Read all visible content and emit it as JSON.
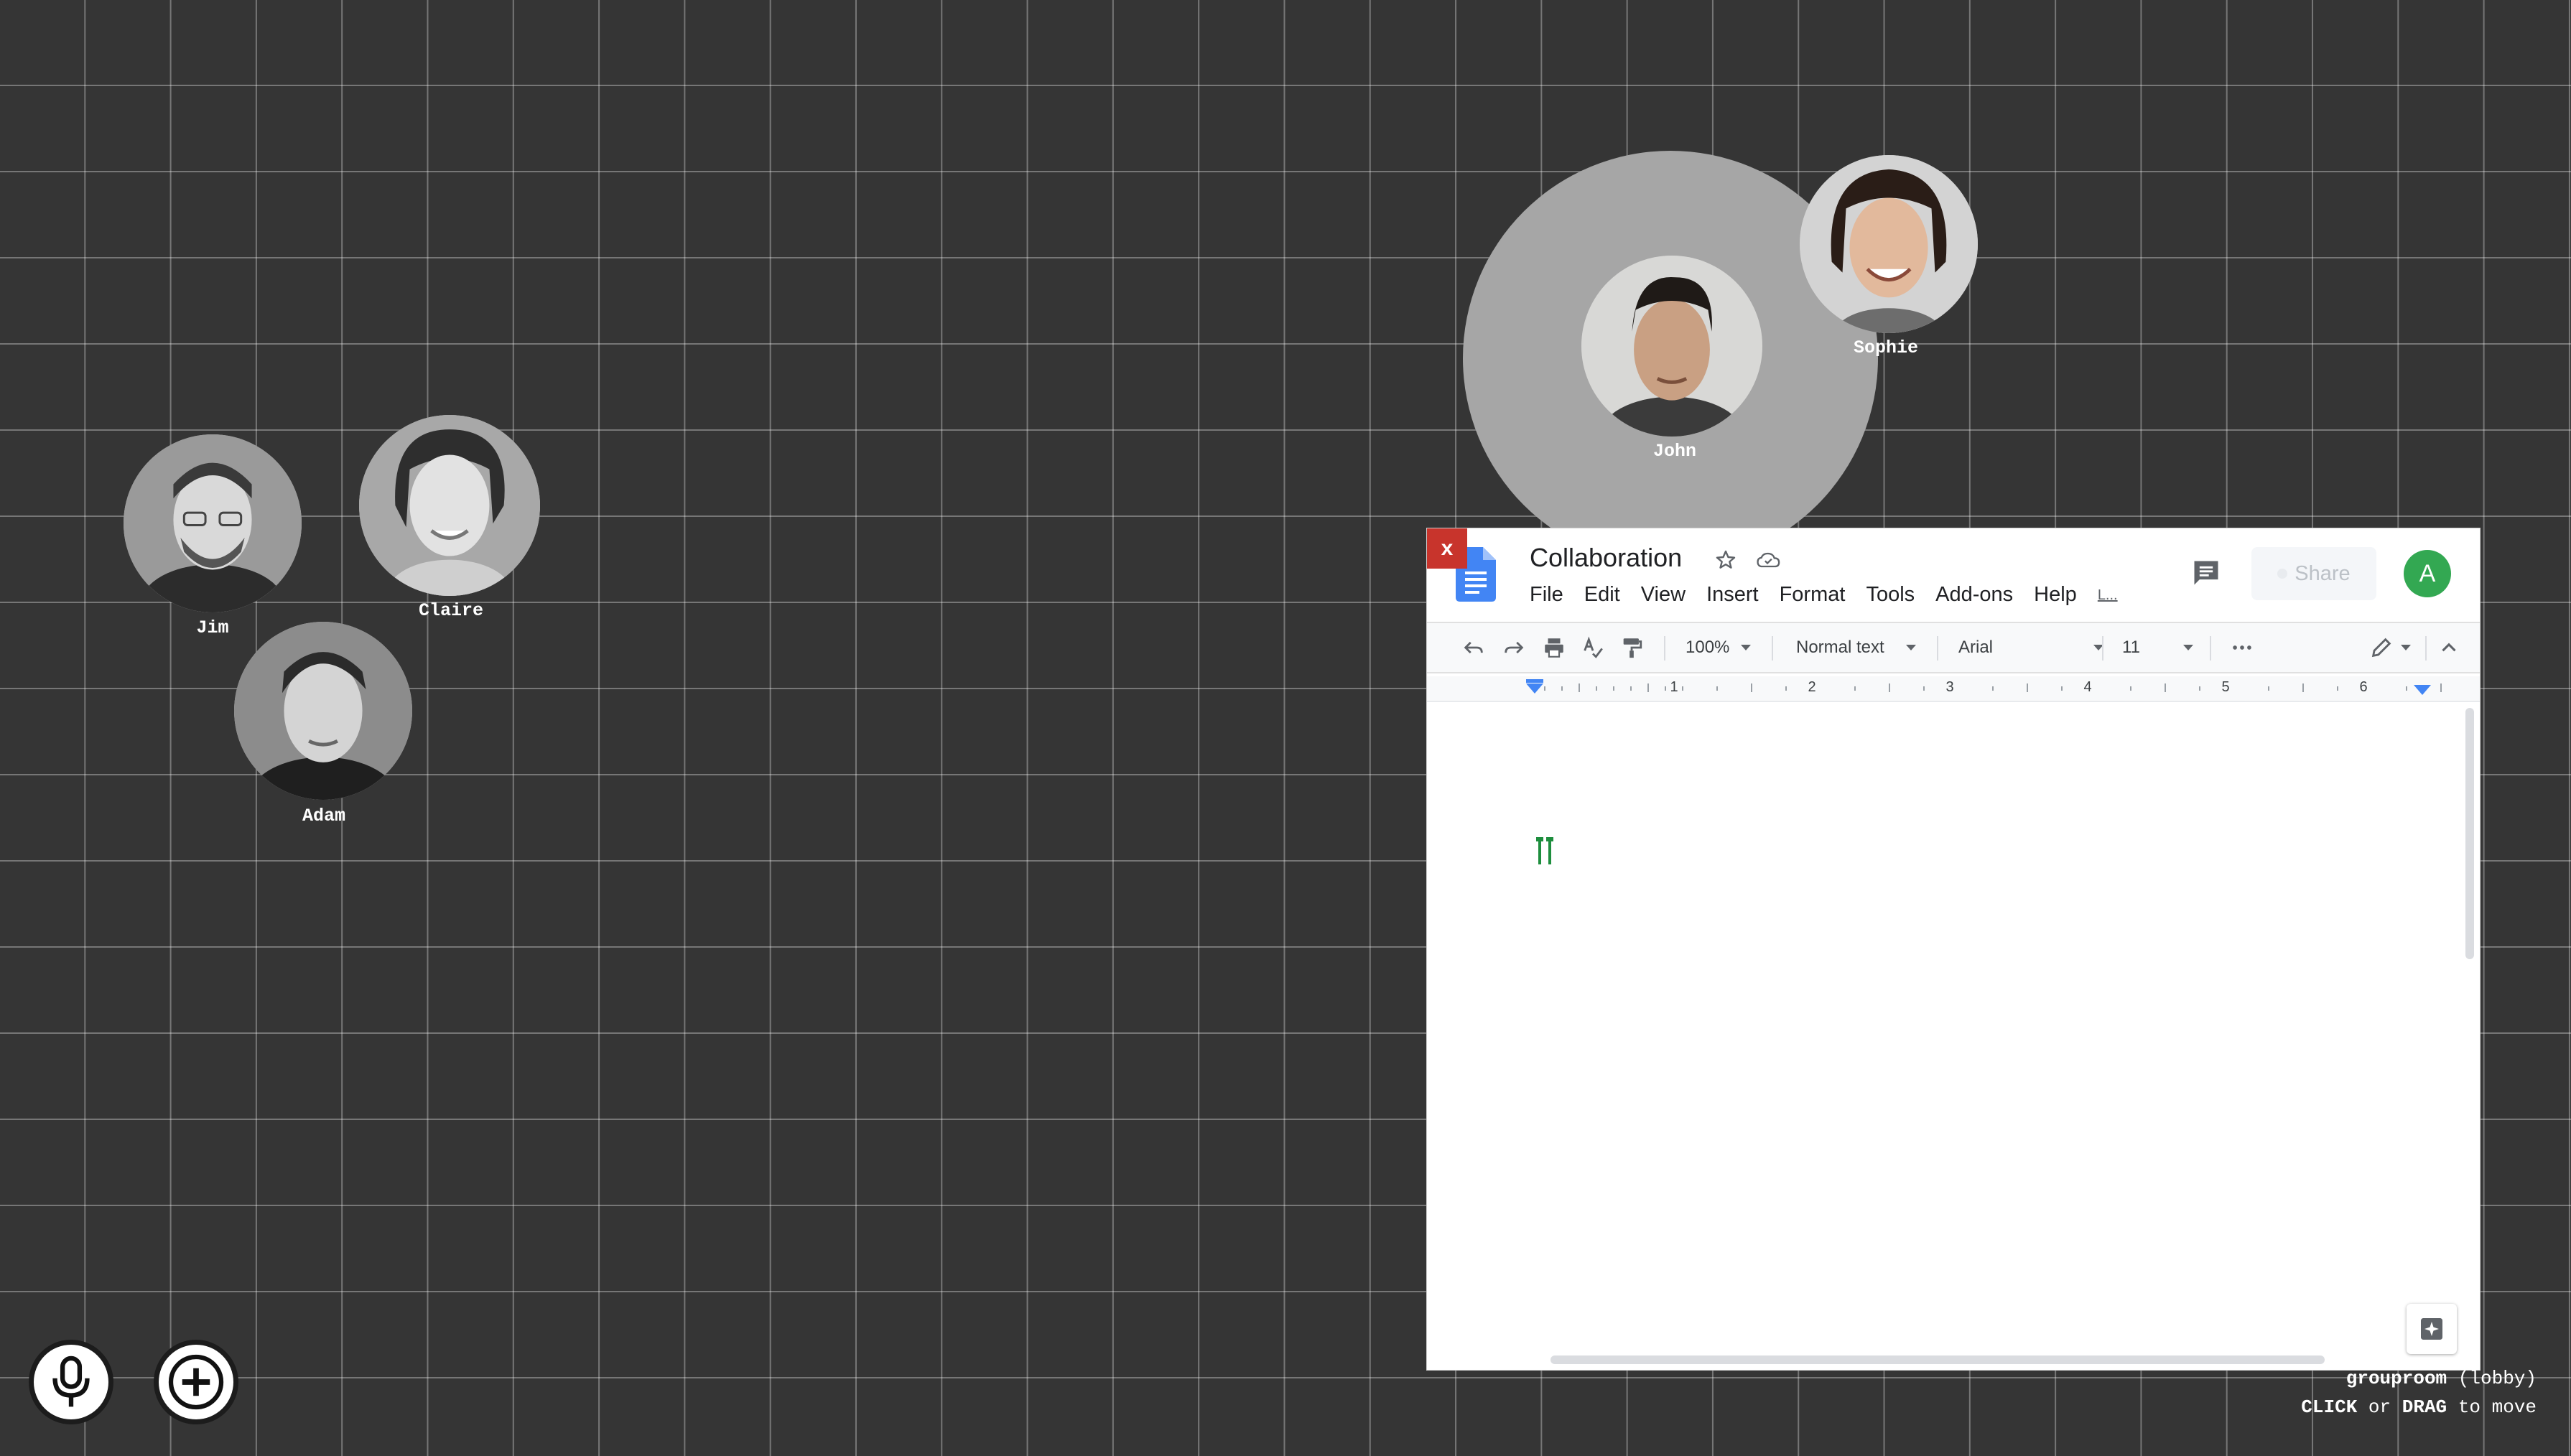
{
  "participants": [
    {
      "name": "Jim"
    },
    {
      "name": "Claire"
    },
    {
      "name": "Adam"
    },
    {
      "name": "John"
    },
    {
      "name": "Sophie"
    }
  ],
  "controls": {
    "microphone_icon": "microphone-icon",
    "add_icon": "plus-icon"
  },
  "status": {
    "room_name": "grouproom",
    "room_state": "(lobby)",
    "hint_click": "CLICK",
    "hint_or": "or",
    "hint_drag": "DRAG",
    "hint_rest": "to move"
  },
  "doc": {
    "close_label": "x",
    "title": "Collaboration",
    "menu": [
      "File",
      "Edit",
      "View",
      "Insert",
      "Format",
      "Tools",
      "Add-ons",
      "Help",
      "L..."
    ],
    "share_label": "Share",
    "account_initial": "A",
    "toolbar": {
      "zoom": "100%",
      "style": "Normal text",
      "font": "Arial",
      "size": "11"
    },
    "ruler_numbers": [
      "1",
      "2",
      "3",
      "4",
      "5",
      "6"
    ]
  },
  "colors": {
    "background": "#353535",
    "close_button": "#c8342c",
    "account_avatar": "#33a852",
    "docs_blue": "#4285f4"
  }
}
